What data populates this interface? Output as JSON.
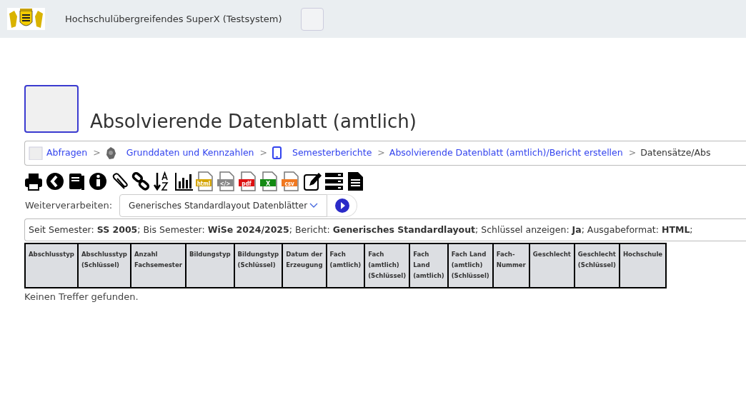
{
  "header": {
    "title": "Hochschulübergreifendes SuperX (Testsystem)"
  },
  "page": {
    "title": "Absolvierende Datenblatt (amtlich)"
  },
  "breadcrumb": [
    {
      "kind": "folder",
      "label": "Abfragen"
    },
    {
      "kind": "emblem",
      "label": "Grunddaten und Kennzahlen",
      "separator": ">"
    },
    {
      "kind": "tablet",
      "label": "Semesterberichte",
      "separator": ">"
    },
    {
      "kind": "link",
      "label": "Absolvierende Datenblatt (amtlich)/Bericht erstellen",
      "separator": ">"
    },
    {
      "kind": "current",
      "label": "Datensätze/Abs",
      "separator": ">"
    }
  ],
  "toolbar": [
    {
      "kind": "print"
    },
    {
      "kind": "back"
    },
    {
      "kind": "book"
    },
    {
      "kind": "info"
    },
    {
      "kind": "clip"
    },
    {
      "kind": "chain"
    },
    {
      "kind": "sort"
    },
    {
      "kind": "chart"
    },
    {
      "kind": "file",
      "label": "html",
      "color": "#d4a400"
    },
    {
      "kind": "file",
      "label": "</>",
      "color": "#888888"
    },
    {
      "kind": "file",
      "label": "pdf",
      "color": "#dd1111"
    },
    {
      "kind": "file",
      "label": "X",
      "color": "#138a13"
    },
    {
      "kind": "file",
      "label": "csv",
      "color": "#f07820"
    },
    {
      "kind": "edit"
    },
    {
      "kind": "server"
    },
    {
      "kind": "doc"
    }
  ],
  "further": {
    "label": "Weiterverarbeiten:",
    "value": "Generisches Standardlayout Datenblätter"
  },
  "filter": "Seit Semester:  **SS 2005**; Bis Semester:  **WiSe 2024/2025**; Bericht:  **Generisches Standardlayout**; Schlüssel anzeigen:  **Ja**; Ausgabeformat:  **HTML**;",
  "table": {
    "columns": [
      "Abschlusstyp",
      "Abschlusstyp (Schlüssel)",
      "Anzahl Fachsemester",
      "Bildungstyp",
      "Bildungstyp (Schlüssel)",
      "Datum der Erzeugung",
      "Fach (amtlich)",
      "Fach (amtlich) (Schlüssel)",
      "Fach Land (amtlich)",
      "Fach Land (amtlich) (Schlüssel)",
      "Fach-Nummer",
      "Geschlecht",
      "Geschlecht (Schlüssel)",
      "Hochschule"
    ],
    "empty_message": "Keinen Treffer gefunden."
  }
}
